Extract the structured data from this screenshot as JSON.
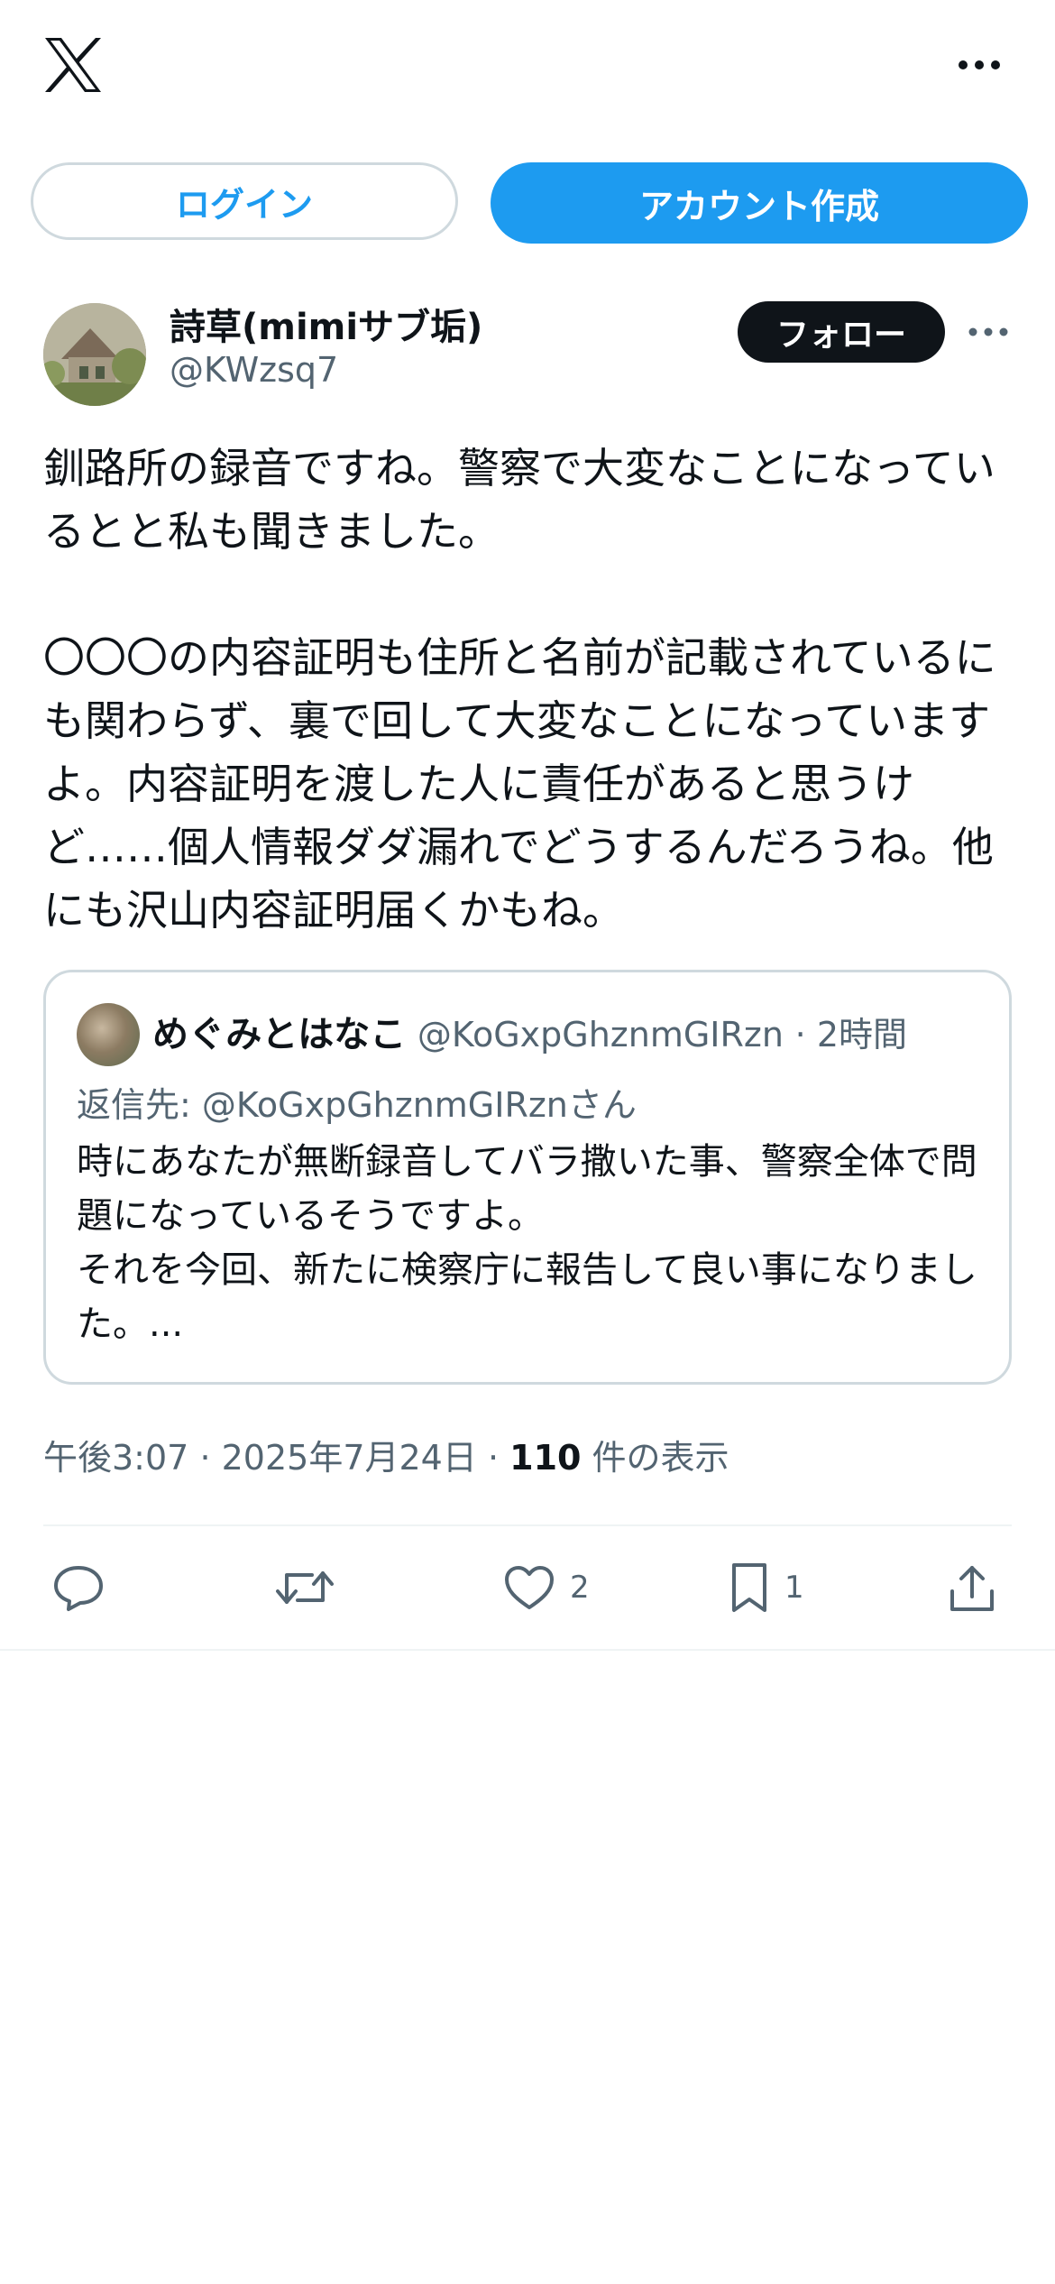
{
  "header": {
    "logo_icon": "x-logo-icon",
    "more_icon": "more-horizontal-icon"
  },
  "auth": {
    "login_label": "ログイン",
    "signup_label": "アカウント作成"
  },
  "author": {
    "name": "詩草(mimiサブ垢)",
    "handle": "@KWzsq7",
    "follow_label": "フォロー"
  },
  "tweet": {
    "text": "釧路所の録音ですね。警察で大変なことになっているとと私も聞きました。\n\n〇〇〇の内容証明も住所と名前が記載されているにも関わらず、裏で回して大変なことになっていますよ。内容証明を渡した人に責任があると思うけど……個人情報ダダ漏れでどうするんだろうね。他にも沢山内容証明届くかもね。"
  },
  "quote": {
    "name": "めぐみとはなこ",
    "handle": "@KoGxpGhznmGIRzn",
    "time": "2時間",
    "reply_prefix": "返信先: ",
    "reply_handle": "@KoGxpGhznmGIRznさん",
    "text": "時にあなたが無断録音してバラ撒いた事、警察全体で問題になっているそうですよ。\nそれを今回、新たに検察庁に報告して良い事になりました。..."
  },
  "meta": {
    "time": "午後3:07",
    "date": "2025年7月24日",
    "views_count": "110",
    "views_label": "件の表示"
  },
  "actions": {
    "reply_icon": "reply-icon",
    "retweet_icon": "retweet-icon",
    "like_icon": "heart-icon",
    "like_count": "2",
    "bookmark_icon": "bookmark-icon",
    "bookmark_count": "1",
    "share_icon": "share-icon"
  },
  "colors": {
    "accent": "#1d9bf0",
    "text_primary": "#0f1419",
    "text_secondary": "#536471",
    "border": "#cfd9de"
  }
}
